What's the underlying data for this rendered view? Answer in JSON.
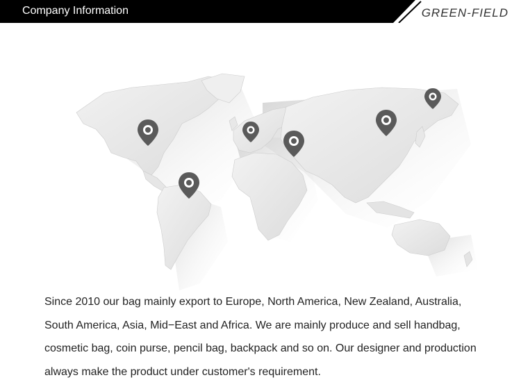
{
  "header": {
    "title": "Company Information",
    "brand": "GREEN-FIELD"
  },
  "map": {
    "pins": [
      {
        "name": "map-pin-north-america"
      },
      {
        "name": "map-pin-south-america"
      },
      {
        "name": "map-pin-europe"
      },
      {
        "name": "map-pin-middle-east"
      },
      {
        "name": "map-pin-china"
      },
      {
        "name": "map-pin-russia-east"
      }
    ]
  },
  "description": {
    "lines": [
      "Since 2010 our bag mainly export to Europe, North America, New Zealand, Australia,",
      "South America, Asia, Mid−East and Africa. We are mainly produce and sell handbag,",
      "cosmetic bag, coin purse, pencil bag, backpack and so on. Our designer and production",
      "always make the product under customer's requirement."
    ]
  },
  "colors": {
    "header_bg": "#000000",
    "pin": "#5a5a5a",
    "map_land": "#e7e7e7"
  }
}
